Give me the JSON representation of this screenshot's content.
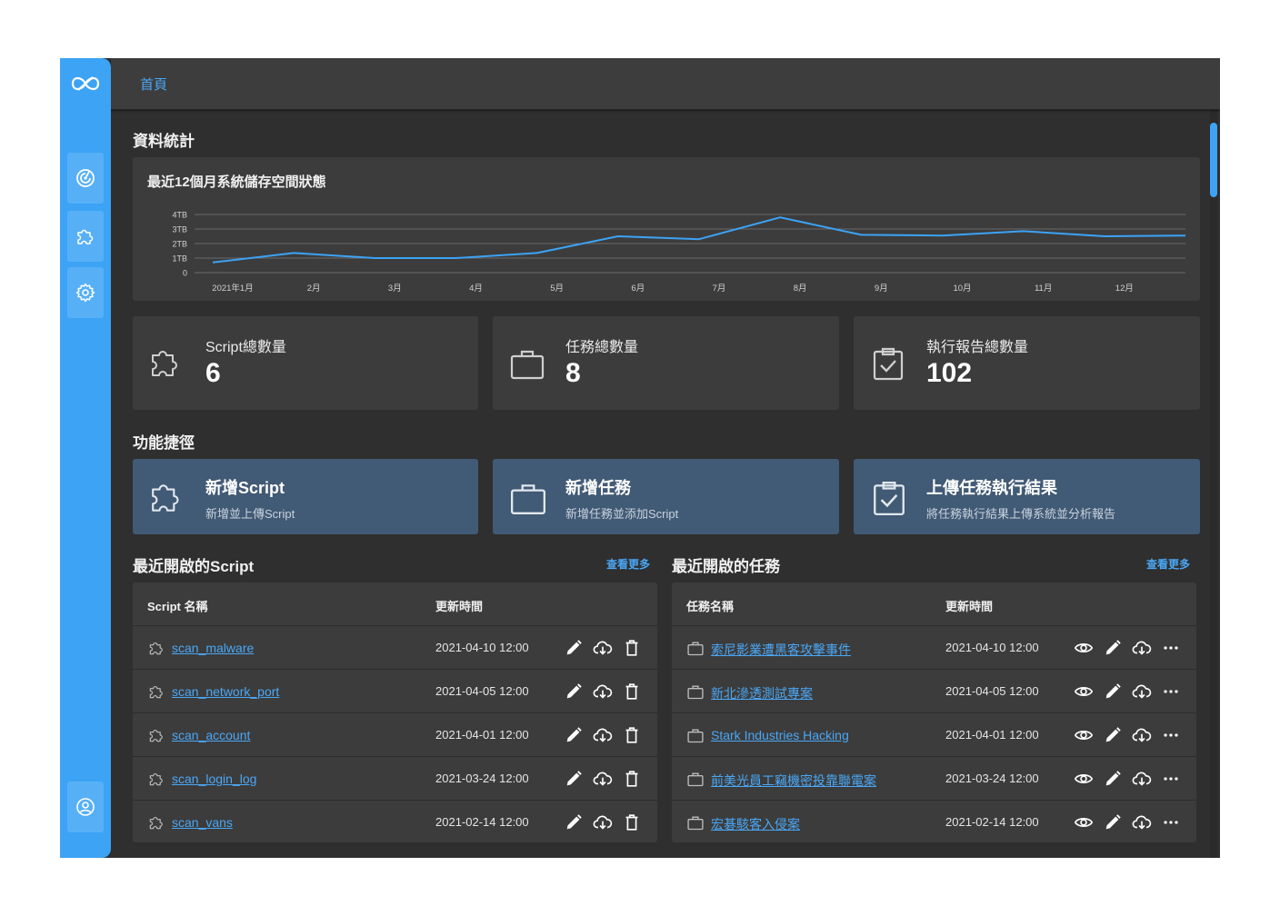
{
  "breadcrumb": {
    "home": "首頁"
  },
  "colors": {
    "accent": "#3ca3f5",
    "panel": "#3c3c3c",
    "shortcut": "#415a75",
    "background": "#2f2f2f"
  },
  "sidebar": {
    "logo_icon": "infinity-logo-icon",
    "items": [
      {
        "name": "dashboard",
        "icon": "radar-icon"
      },
      {
        "name": "scripts",
        "icon": "puzzle-icon"
      },
      {
        "name": "settings",
        "icon": "gear-icon"
      }
    ],
    "footer_icon": "user-icon"
  },
  "stats_section": {
    "title": "資料統計",
    "chart_title": "最近12個月系統儲存空間狀態",
    "cards": [
      {
        "label": "Script總數量",
        "value": "6",
        "icon": "puzzle-icon"
      },
      {
        "label": "任務總數量",
        "value": "8",
        "icon": "briefcase-icon"
      },
      {
        "label": "執行報告總數量",
        "value": "102",
        "icon": "clipboard-check-icon"
      }
    ]
  },
  "chart_data": {
    "type": "line",
    "title": "最近12個月系統儲存空間狀態",
    "categories": [
      "2021年1月",
      "2月",
      "3月",
      "4月",
      "5月",
      "6月",
      "7月",
      "8月",
      "9月",
      "10月",
      "11月",
      "12月"
    ],
    "series": [
      {
        "values": [
          0.7,
          1.35,
          1.0,
          1.0,
          1.35,
          2.5,
          2.3,
          3.8,
          2.6,
          2.55,
          2.85,
          2.5,
          2.55
        ]
      }
    ],
    "y_ticks": [
      "0",
      "1TB",
      "2TB",
      "3TB",
      "4TB"
    ],
    "ylim": [
      0,
      4
    ],
    "ylabel": "",
    "xlabel": "",
    "grid": true,
    "color": "#3ca3f5"
  },
  "shortcuts": {
    "title": "功能捷徑",
    "items": [
      {
        "title": "新增Script",
        "desc": "新增並上傳Script",
        "icon": "puzzle-icon"
      },
      {
        "title": "新增任務",
        "desc": "新增任務並添加Script",
        "icon": "briefcase-icon"
      },
      {
        "title": "上傳任務執行結果",
        "desc": "將任務執行結果上傳系統並分析報告",
        "icon": "clipboard-check-icon"
      }
    ]
  },
  "recent_scripts": {
    "title": "最近開啟的Script",
    "see_more": "查看更多",
    "columns": [
      "Script 名稱",
      "更新時間"
    ],
    "rows": [
      {
        "name": "scan_malware",
        "time": "2021-04-10 12:00"
      },
      {
        "name": "scan_network_port",
        "time": "2021-04-05 12:00"
      },
      {
        "name": "scan_account",
        "time": "2021-04-01 12:00"
      },
      {
        "name": "scan_login_log",
        "time": "2021-03-24 12:00"
      },
      {
        "name": "scan_vans",
        "time": "2021-02-14 12:00"
      }
    ],
    "actions": [
      "pencil-icon",
      "cloud-download-icon",
      "trash-icon"
    ]
  },
  "recent_tasks": {
    "title": "最近開啟的任務",
    "see_more": "查看更多",
    "columns": [
      "任務名稱",
      "更新時間"
    ],
    "rows": [
      {
        "name": "索尼影業遭黑客攻擊事件",
        "time": "2021-04-10 12:00"
      },
      {
        "name": "新北滲透測試專案",
        "time": "2021-04-05 12:00"
      },
      {
        "name": "Stark Industries Hacking",
        "time": "2021-04-01 12:00"
      },
      {
        "name": "前美光員工竊機密投靠聯電案",
        "time": "2021-03-24 12:00"
      },
      {
        "name": "宏碁駭客入侵案",
        "time": "2021-02-14 12:00"
      }
    ],
    "actions": [
      "eye-icon",
      "pencil-icon",
      "cloud-download-icon",
      "more-icon"
    ]
  }
}
